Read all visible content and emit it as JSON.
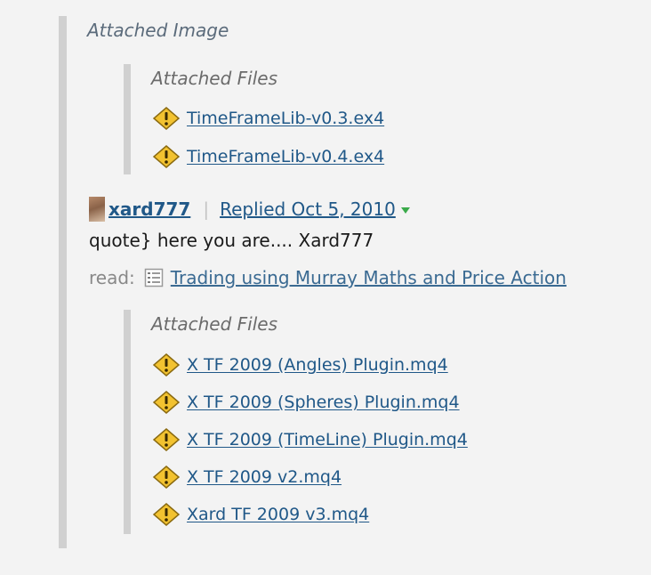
{
  "quote": {
    "attached_image_label": "Attached Image"
  },
  "files_block_1": {
    "title": "Attached Files",
    "files": [
      {
        "name": "TimeFrameLib-v0.3.ex4",
        "icon": "warning-icon"
      },
      {
        "name": "TimeFrameLib-v0.4.ex4",
        "icon": "warning-icon"
      }
    ]
  },
  "post": {
    "username": "xard777",
    "separator": "|",
    "replied_label": "Replied Oct 5, 2010",
    "body": "quote} here you are.... Xard777",
    "thread_label": "read:",
    "thread_title": "Trading using Murray Maths and Price Action"
  },
  "files_block_2": {
    "title": "Attached Files",
    "files": [
      {
        "name": "X TF 2009 (Angles) Plugin.mq4",
        "icon": "warning-icon"
      },
      {
        "name": "X TF 2009 (Spheres) Plugin.mq4",
        "icon": "warning-icon"
      },
      {
        "name": "X TF 2009 (TimeLine) Plugin.mq4",
        "icon": "warning-icon"
      },
      {
        "name": "X TF 2009 v2.mq4",
        "icon": "warning-icon"
      },
      {
        "name": "Xard TF 2009 v3.mq4",
        "icon": "warning-icon"
      }
    ]
  },
  "colors": {
    "link": "#205888",
    "quote_bar": "#d0d0d0",
    "background": "#f3f3f3",
    "warning_fill": "#f2c230",
    "caret": "#3aaa4a"
  }
}
